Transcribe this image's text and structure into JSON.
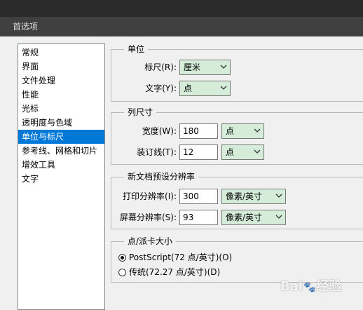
{
  "window": {
    "title": "首选项"
  },
  "sidebar": {
    "items": [
      {
        "label": "常规"
      },
      {
        "label": "界面"
      },
      {
        "label": "文件处理"
      },
      {
        "label": "性能"
      },
      {
        "label": "光标"
      },
      {
        "label": "透明度与色域"
      },
      {
        "label": "单位与标尺",
        "selected": true
      },
      {
        "label": "参考线、网格和切片"
      },
      {
        "label": "增效工具"
      },
      {
        "label": "文字"
      }
    ]
  },
  "units": {
    "title": "单位",
    "ruler_label": "标尺(R):",
    "ruler_value": "厘米",
    "type_label": "文字(Y):",
    "type_value": "点"
  },
  "column": {
    "title": "列尺寸",
    "width_label": "宽度(W):",
    "width_value": "180",
    "width_unit": "点",
    "gutter_label": "装订线(T):",
    "gutter_value": "12",
    "gutter_unit": "点"
  },
  "resolution": {
    "title": "新文档预设分辨率",
    "print_label": "打印分辨率(I):",
    "print_value": "300",
    "print_unit": "像素/英寸",
    "screen_label": "屏幕分辨率(S):",
    "screen_value": "93",
    "screen_unit": "像素/英寸"
  },
  "point_size": {
    "title": "点/派卡大小",
    "option1": "PostScript(72 点/英寸)(O)",
    "option2": "传统(72.27 点/英寸)(D)",
    "selected": "option1"
  },
  "watermark": {
    "text_left": "Bai",
    "text_right": "经验"
  },
  "colors": {
    "selection": "#0078d7",
    "dropdown_bg": "#d5ecd9"
  }
}
